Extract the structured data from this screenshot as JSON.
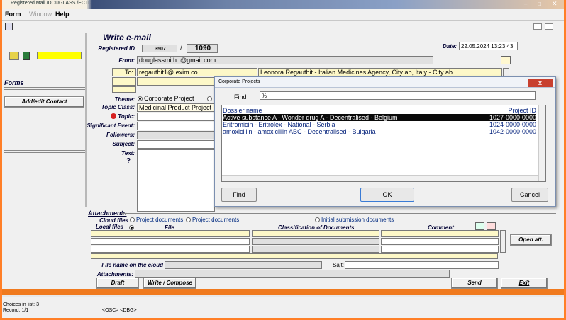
{
  "window": {
    "title": "Registered Mail /DOUGLASS /ECTD"
  },
  "menu": {
    "form": "Form",
    "window": "Window",
    "help": "Help"
  },
  "left": {
    "forms_heading": "Forms",
    "add_edit_contact": "Add/edit Contact"
  },
  "form": {
    "heading": "Write e-mail",
    "registered_id_label": "Registered ID",
    "registered_id_a": "3507",
    "registered_id_sep": "/",
    "registered_id_b": "1090",
    "date_label": "Date:",
    "date_value": "22.05.2024 13:23:43",
    "from_label": "From:",
    "from_value": "douglassmith.      @gmail.com",
    "to_label": "To:",
    "to_value": "regauthit1@     exim.co.",
    "to_name": "Leonora Regauthit - Italian Medicines Agency, City ab, Italy - City ab",
    "theme_label": "Theme:",
    "theme_option1": "Corporate Project",
    "topic_class_label": "Topic Class:",
    "topic_class_value": "Medicinal Product Project",
    "topic_label": "Topic:",
    "significant_event_label": "Significant Event:",
    "followers_label": "Followers:",
    "subject_label": "Subject:",
    "text_label": "Text:",
    "help_mark": "?"
  },
  "attachments": {
    "heading": "Attachments",
    "cloud_files_label": "Cloud files",
    "cloud_opt1": "Project documents",
    "cloud_opt2": "Project documents 2",
    "cloud_opt3": "Initial submission documents",
    "local_files_label": "Local files",
    "col_file": "File",
    "col_classification": "Classification of Documents",
    "col_comment": "Comment",
    "open_att": "Open att.",
    "file_name_cloud_label": "File name on the cloud",
    "sajt_label": "Sajt:",
    "attachments_label": "Attachments:"
  },
  "buttons": {
    "draft": "Draft",
    "write_compose": "Write / Compose",
    "send": "Send",
    "exit": "Exit"
  },
  "dialog": {
    "title": "Corporate Projects",
    "close": "x",
    "find_label": "Find",
    "find_value": "%",
    "col_dossier": "Dossier name",
    "col_project_id": "Project ID",
    "rows": [
      {
        "name": "Active substance A - Wonder drug A - Decentralised - Belgium",
        "id": "1027-0000-0000"
      },
      {
        "name": "Eritromicin - Eritrolex - National - Serbia",
        "id": "1024-0000-0000"
      },
      {
        "name": "amoxicillin - amoxicillin ABC - Decentralised - Bulgaria",
        "id": "1042-0000-0000"
      }
    ],
    "find_button": "Find",
    "ok_button": "OK",
    "cancel_button": "Cancel"
  },
  "status": {
    "choices": "Choices in list: 3",
    "record": "Record: 1/1",
    "mode": "<OSC> <DBG>"
  }
}
